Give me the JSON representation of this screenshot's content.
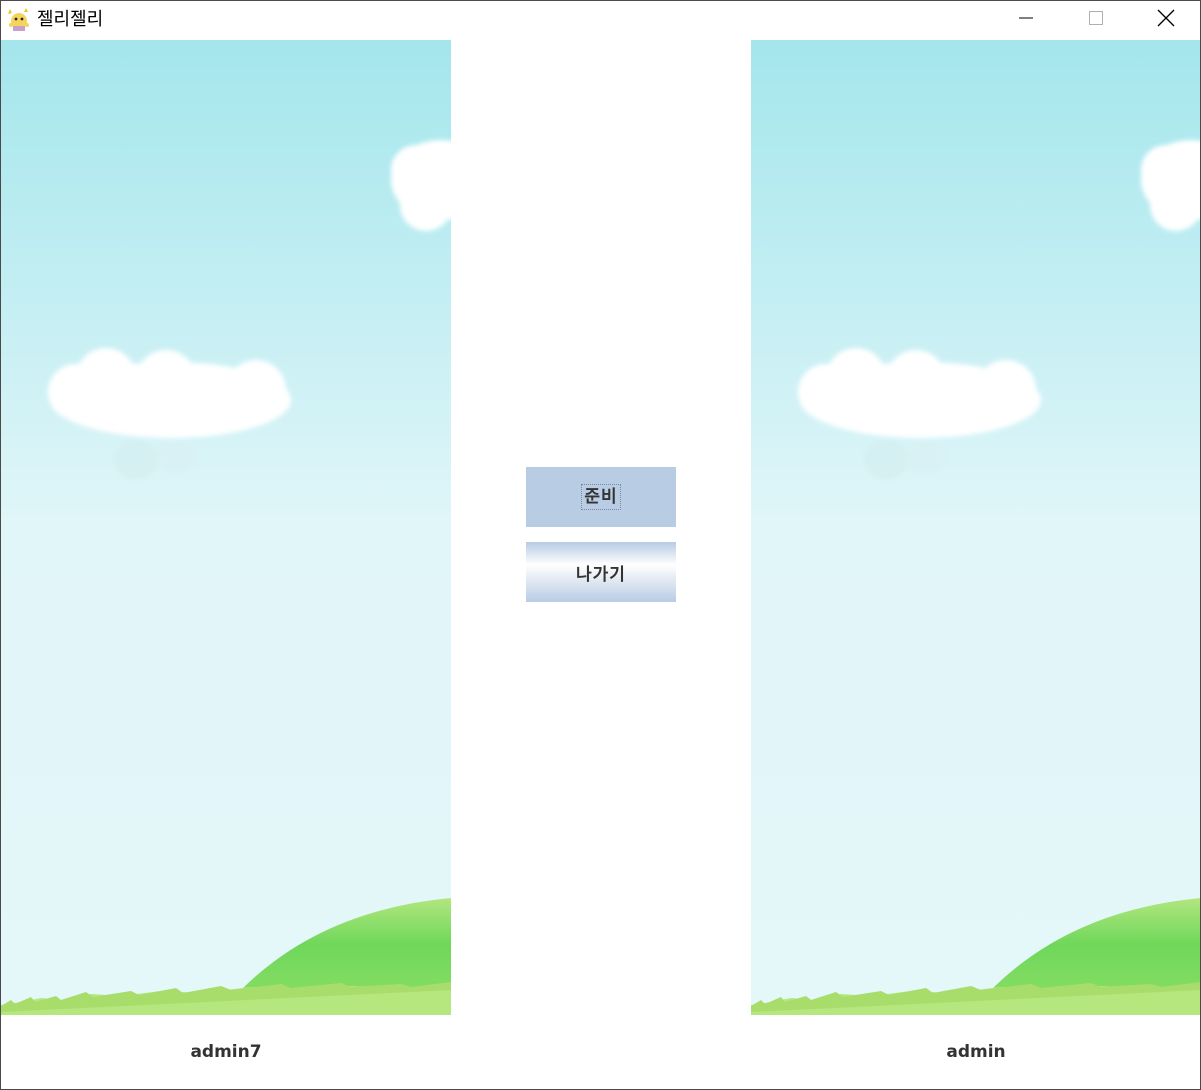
{
  "window": {
    "title": "젤리젤리",
    "app_icon": "jelly-character-icon",
    "controls": {
      "minimize_icon": "minimize-icon",
      "maximize_icon": "maximize-icon",
      "close_icon": "close-icon"
    }
  },
  "players": {
    "left": {
      "username": "admin7"
    },
    "right": {
      "username": "admin"
    }
  },
  "buttons": {
    "ready_label": "준비",
    "exit_label": "나가기"
  },
  "colors": {
    "sky_top": "#a3e6ec",
    "sky_bottom": "#e4f7f9",
    "hill": "#7bd863",
    "grass": "#b6e67e",
    "button_blue": "#b8cce4"
  }
}
